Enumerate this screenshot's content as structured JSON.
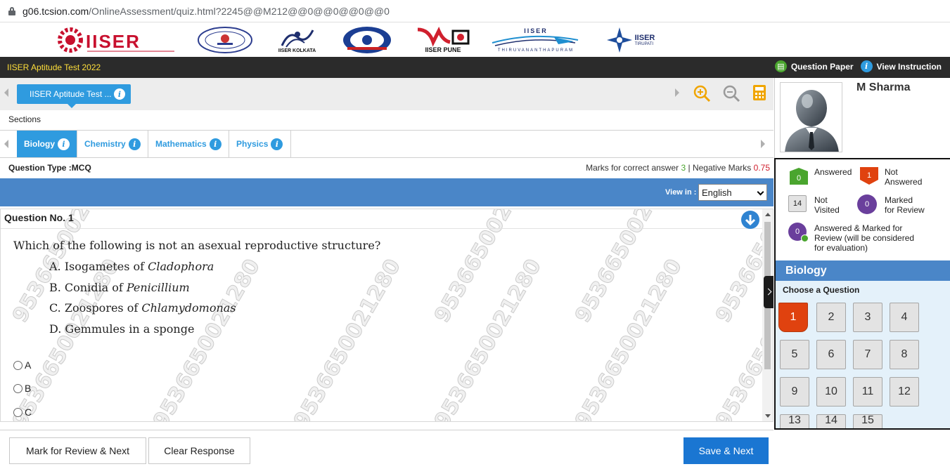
{
  "browser": {
    "url_host": "g06.tcsion.com",
    "url_path": "/OnlineAssessment/quiz.html?2245@@M212@@0@@0@@0@@0"
  },
  "logos": [
    {
      "name": "iiser-logo",
      "text": "IISER"
    },
    {
      "name": "iiser-bhopal-seal-logo",
      "text": ""
    },
    {
      "name": "iiser-kolkata-logo",
      "text": "IISER KOLKATA"
    },
    {
      "name": "iiser-mohali-seal-logo",
      "text": ""
    },
    {
      "name": "iiser-pune-logo",
      "text": "IISER PUNE"
    },
    {
      "name": "iiser-tvm-logo",
      "text": "IISER",
      "sub": "THIRUVANANTHAPURAM"
    },
    {
      "name": "iiser-tirupati-logo",
      "text": "IISER",
      "sub": "TIRUPATI"
    }
  ],
  "header": {
    "title": "IISER Aptitude Test 2022",
    "question_paper": "Question Paper",
    "view_instruction": "View Instruction"
  },
  "test_tab": {
    "label": "IISER Aptitude Test ..."
  },
  "sections": {
    "label": "Sections",
    "tabs": [
      {
        "label": "Biology",
        "active": true
      },
      {
        "label": "Chemistry",
        "active": false
      },
      {
        "label": "Mathematics",
        "active": false
      },
      {
        "label": "Physics",
        "active": false
      }
    ]
  },
  "question_info": {
    "type": "Question Type :MCQ",
    "marks_prefix": "Marks for correct answer ",
    "correct": "3",
    "separator": " | Negative Marks ",
    "negative": "0.75"
  },
  "view_in": {
    "label": "View in :",
    "selected": "English"
  },
  "question": {
    "number": "Question No. 1",
    "text": "Which of the following is not an asexual reproductive structure?",
    "options": [
      {
        "prefix": "A.  Isogametes of ",
        "italic": "Cladophora"
      },
      {
        "prefix": "B.  Conidia of ",
        "italic": "Penicillium"
      },
      {
        "prefix": "C.  Zoospores of ",
        "italic": "Chlamydomonas"
      },
      {
        "prefix": "D.  Gemmules in a sponge",
        "italic": ""
      }
    ],
    "choices": [
      "A",
      "B",
      "C"
    ]
  },
  "watermark": "9536650021280",
  "buttons": {
    "mark_review": "Mark for Review & Next",
    "clear": "Clear Response",
    "save_next": "Save & Next"
  },
  "candidate": {
    "name": "M Sharma"
  },
  "legend": {
    "answered": {
      "count": "0",
      "label_1": "Answered",
      "label_2": ""
    },
    "not_answered": {
      "count": "1",
      "label_1": "Not",
      "label_2": "Answered"
    },
    "not_visited": {
      "count": "14",
      "label_1": "Not",
      "label_2": "Visited"
    },
    "marked": {
      "count": "0",
      "label_1": "Marked",
      "label_2": "for Review"
    },
    "answered_marked": {
      "count": "0",
      "label_1": "Answered & Marked for",
      "label_2": "Review (will be considered",
      "label_3": "for evaluation)"
    }
  },
  "palette": {
    "section": "Biology",
    "subtitle": "Choose a Question",
    "questions": [
      "1",
      "2",
      "3",
      "4",
      "5",
      "6",
      "7",
      "8",
      "9",
      "10",
      "11",
      "12",
      "13",
      "14",
      "15"
    ]
  },
  "colors": {
    "accent": "#2f9bdf",
    "bar_blue": "#4a86c8",
    "header_dark": "#2b2b2b",
    "header_title": "#ffdf3b",
    "not_answered": "#e0420f",
    "answered": "#4aa52e",
    "marked": "#6a3f9c",
    "primary_button": "#1a76d2"
  }
}
